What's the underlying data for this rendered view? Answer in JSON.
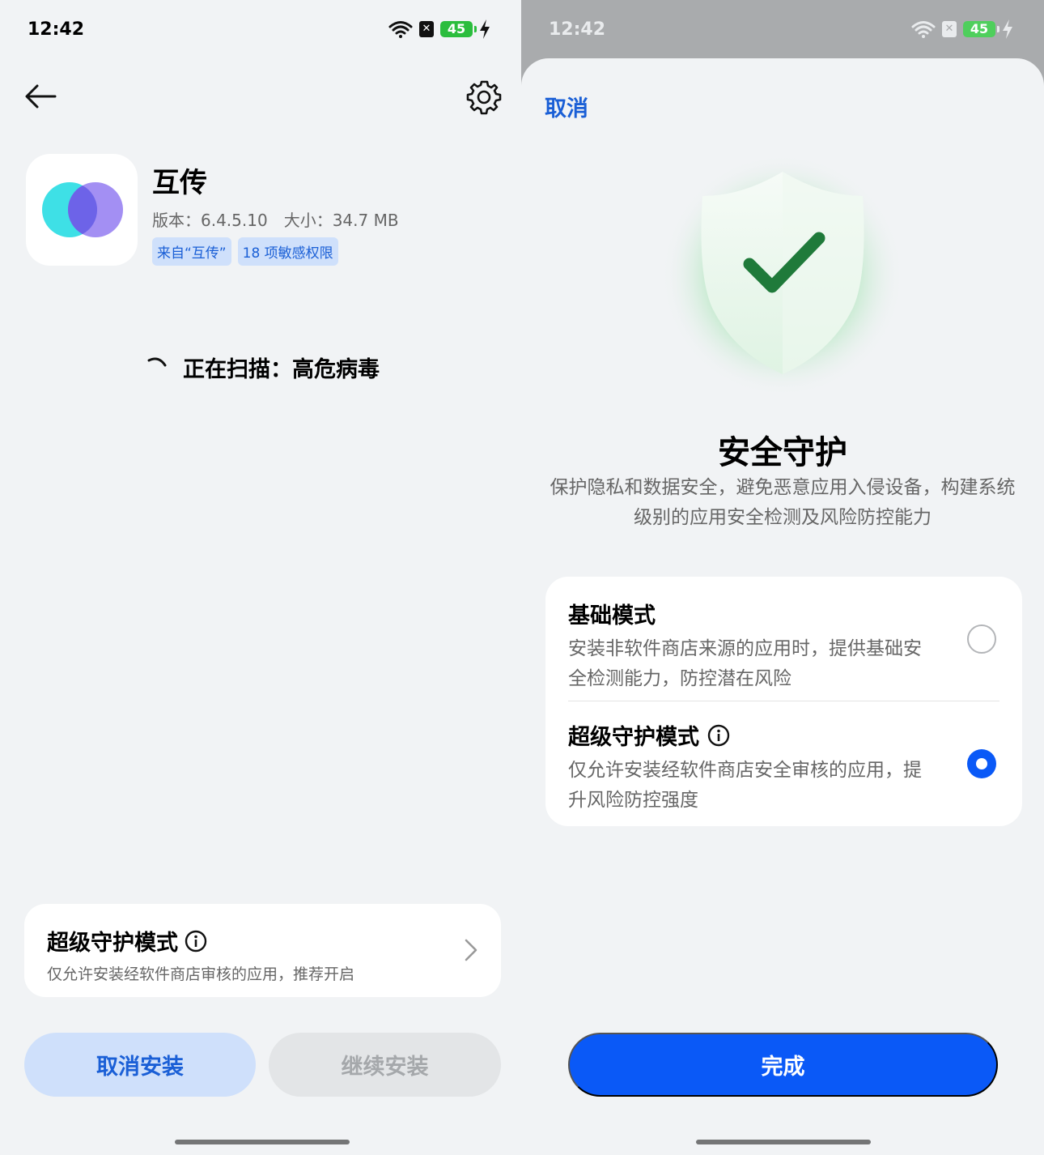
{
  "status": {
    "time": "12:42",
    "battery": "45"
  },
  "left": {
    "app": {
      "name": "互传",
      "meta": "版本：6.4.5.10　大小：34.7 MB",
      "tags": [
        "来自“互传”",
        "18 项敏感权限"
      ]
    },
    "scan_text": "正在扫描：高危病毒",
    "mode_card": {
      "title": "超级守护模式",
      "desc": "仅允许安装经软件商店审核的应用，推荐开启"
    },
    "buttons": {
      "cancel": "取消安装",
      "continue": "继续安装"
    }
  },
  "right": {
    "cancel": "取消",
    "title": "安全守护",
    "desc": "保护隐私和数据安全，避免恶意应用入侵设备，构建系统级别的应用安全检测及风险防控能力",
    "options": [
      {
        "title": "基础模式",
        "desc": "安装非软件商店来源的应用时，提供基础安全检测能力，防控潜在风险",
        "selected": false
      },
      {
        "title": "超级守护模式",
        "desc": "仅允许安装经软件商店安全审核的应用，提升风险防控强度",
        "selected": true
      }
    ],
    "done": "完成"
  },
  "colors": {
    "accent": "#0a59f7",
    "link": "#1a5fd6",
    "battery": "#2bbd3d"
  }
}
